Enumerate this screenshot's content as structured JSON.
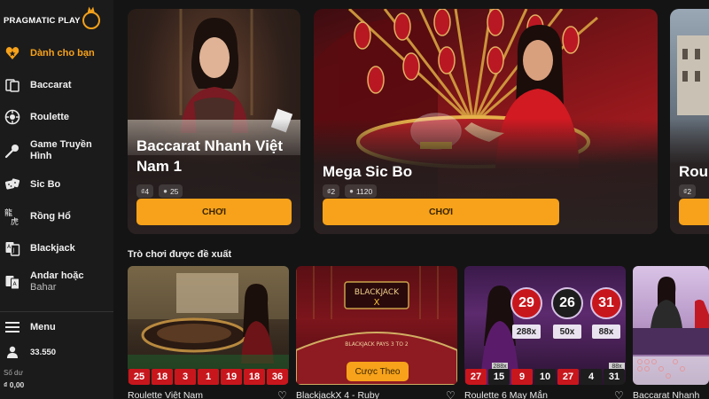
{
  "brand": {
    "logo_text": "PRAGMATIC PLAY"
  },
  "sidebar": {
    "items": [
      {
        "label": "Dành cho bạn",
        "icon": "heart-star-icon",
        "active": true
      },
      {
        "label": "Baccarat",
        "icon": "cards-icon"
      },
      {
        "label": "Roulette",
        "icon": "roulette-wheel-icon"
      },
      {
        "label": "Game Truyền Hình",
        "icon": "microphone-icon"
      },
      {
        "label": "Sic Bo",
        "icon": "dice-icon"
      },
      {
        "label": "Rồng Hổ",
        "icon": "dragon-tiger-icon"
      },
      {
        "label": "Blackjack",
        "icon": "blackjack-cards-icon"
      },
      {
        "label": "Andar hoặc",
        "sub": "Bahar",
        "icon": "andar-bahar-icon"
      }
    ],
    "menu_label": "Menu",
    "points": "33.550",
    "balance_label": "Số dư",
    "balance_value": "₫ 0,00"
  },
  "featured": [
    {
      "title": "Baccarat Nhanh Việt Nam 1",
      "stake": "₫4",
      "players": "25",
      "button": "CHƠI"
    },
    {
      "title": "Mega Sic Bo",
      "stake": "₫2",
      "players": "1120",
      "button": "CHƠI"
    },
    {
      "title": "Roul",
      "stake": "₫2",
      "players": "",
      "button": ""
    }
  ],
  "recommended": {
    "title": "Trò chơi được đề xuất",
    "games": [
      {
        "name": "Roulette Việt Nam",
        "results": [
          "25",
          "18",
          "3",
          "1",
          "19",
          "18",
          "36"
        ]
      },
      {
        "name": "BlackjackX 4 - Ruby",
        "overlay_button": "Cược Theo"
      },
      {
        "name": "Roulette 6 May Mắn",
        "results": [
          "27",
          "15",
          "9",
          "10",
          "27",
          "4",
          "31"
        ],
        "multipliers": [
          "288x",
          "88x"
        ],
        "balls": [
          "29",
          "26",
          "31"
        ],
        "ball_mult": [
          "288x",
          "50x",
          "88x"
        ]
      },
      {
        "name": "Baccarat Nhanh"
      }
    ]
  },
  "colors": {
    "accent": "#f7a21a",
    "bg": "#141414",
    "sidebar": "#1b1b1b",
    "red": "#c8161d"
  }
}
